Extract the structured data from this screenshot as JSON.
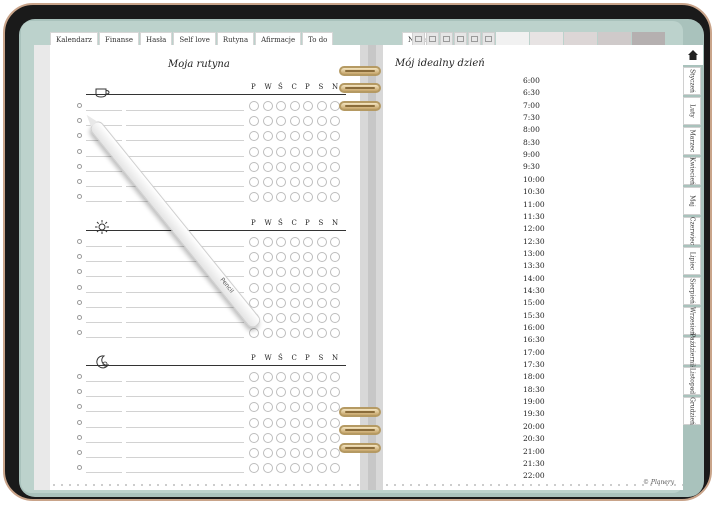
{
  "top_tabs": [
    "Kalendarz",
    "Finanse",
    "Hasła",
    "Self love",
    "Rutyna",
    "Afirmacje",
    "To do",
    "Notes"
  ],
  "right_icon_tabs": [
    "page-icon",
    "split-icon",
    "book-icon",
    "grid-icon",
    "mail-icon",
    "calendar-icon"
  ],
  "right_color_tabs": [
    "#f1f1f1",
    "#e7e3e3",
    "#dcd6d6",
    "#cfcaca",
    "#b5b0b0"
  ],
  "side_tabs": [
    "Styczeń",
    "Luty",
    "Marzec",
    "Kwiecień",
    "Maj",
    "Czerwiec",
    "Lipiec",
    "Sierpień",
    "Wrzesień",
    "Październik",
    "Listopad",
    "Grudzień"
  ],
  "left_page": {
    "title": "Moja rutyna",
    "sections": [
      {
        "icon": "coffee-cup-icon",
        "days": [
          "P",
          "W",
          "Ś",
          "C",
          "P",
          "S",
          "N"
        ]
      },
      {
        "icon": "sun-icon",
        "days": [
          "P",
          "W",
          "Ś",
          "C",
          "P",
          "S",
          "N"
        ]
      },
      {
        "icon": "moon-icon",
        "days": [
          "P",
          "W",
          "Ś",
          "C",
          "P",
          "S",
          "N"
        ]
      }
    ]
  },
  "right_page": {
    "title": "Mój idealny dzień",
    "hours": [
      "6:00",
      "6:30",
      "7:00",
      "7:30",
      "8:00",
      "8:30",
      "9:00",
      "9:30",
      "10:00",
      "10:30",
      "11:00",
      "11:30",
      "12:00",
      "12:30",
      "13:00",
      "13:30",
      "14:00",
      "14:30",
      "15:00",
      "15:30",
      "16:00",
      "16:30",
      "17:00",
      "17:30",
      "18:00",
      "18:30",
      "19:00",
      "19:30",
      "20:00",
      "20:30",
      "21:00",
      "21:30",
      "22:00"
    ]
  },
  "pencil_label": "Pencil",
  "logo_text": "© Planery"
}
